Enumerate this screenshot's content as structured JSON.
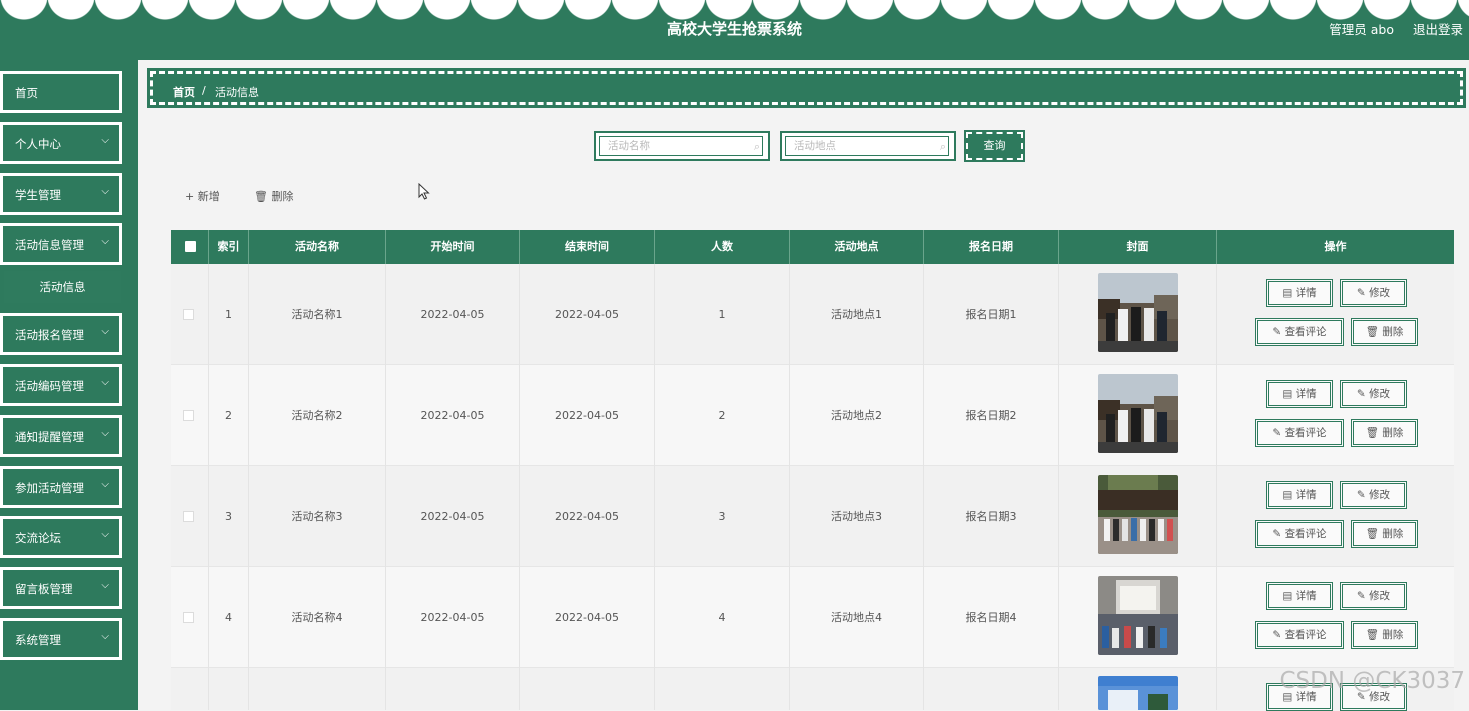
{
  "header": {
    "title": "高校大学生抢票系统",
    "admin": "管理员 abo",
    "logout": "退出登录"
  },
  "sidebar": {
    "items": [
      {
        "label": "首页",
        "chevron": false
      },
      {
        "label": "个人中心",
        "chevron": true
      },
      {
        "label": "学生管理",
        "chevron": true
      },
      {
        "label": "活动信息管理",
        "chevron": true
      },
      {
        "label": "活动报名管理",
        "chevron": true
      },
      {
        "label": "活动编码管理",
        "chevron": true
      },
      {
        "label": "通知提醒管理",
        "chevron": true
      },
      {
        "label": "参加活动管理",
        "chevron": true
      },
      {
        "label": "交流论坛",
        "chevron": true
      },
      {
        "label": "留言板管理",
        "chevron": true
      },
      {
        "label": "系统管理",
        "chevron": true
      }
    ],
    "sub_item": "活动信息"
  },
  "breadcrumb": {
    "home": "首页",
    "separator": "/",
    "current": "活动信息"
  },
  "search": {
    "name_placeholder": "活动名称",
    "place_placeholder": "活动地点",
    "query_button": "查询"
  },
  "toolbar": {
    "add": "+ 新增",
    "delete": "🗑 删除"
  },
  "table": {
    "headers": [
      "索引",
      "活动名称",
      "开始时间",
      "结束时间",
      "人数",
      "活动地点",
      "报名日期",
      "封面",
      "操作"
    ],
    "rows": [
      {
        "index": "1",
        "name": "活动名称1",
        "start": "2022-04-05",
        "end": "2022-04-05",
        "count": "1",
        "place": "活动地点1",
        "date": "报名日期1"
      },
      {
        "index": "2",
        "name": "活动名称2",
        "start": "2022-04-05",
        "end": "2022-04-05",
        "count": "2",
        "place": "活动地点2",
        "date": "报名日期2"
      },
      {
        "index": "3",
        "name": "活动名称3",
        "start": "2022-04-05",
        "end": "2022-04-05",
        "count": "3",
        "place": "活动地点3",
        "date": "报名日期3"
      },
      {
        "index": "4",
        "name": "活动名称4",
        "start": "2022-04-05",
        "end": "2022-04-05",
        "count": "4",
        "place": "活动地点4",
        "date": "报名日期4"
      }
    ],
    "actions": {
      "detail": "详情",
      "edit": "修改",
      "comments": "查看评论",
      "delete": "删除"
    }
  },
  "watermark": "CSDN @CK3037",
  "colors": {
    "primary": "#2e7a5d",
    "row_odd": "#f1f1f1",
    "row_even": "#f7f7f7",
    "white": "#ffffff"
  },
  "icons": [
    "search-icon",
    "plus-icon",
    "trash-icon",
    "doc-icon",
    "pencil-icon",
    "chevron-down-icon",
    "cursor-arrow-icon"
  ]
}
